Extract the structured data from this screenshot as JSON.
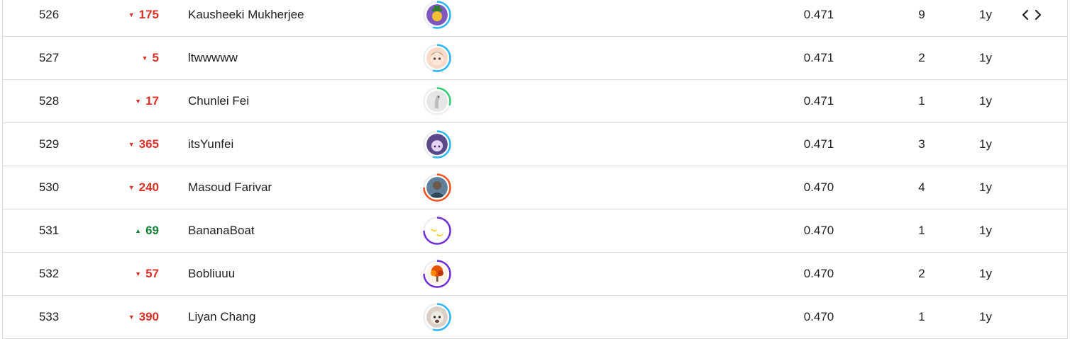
{
  "leaderboard": {
    "rows": [
      {
        "rank": "526",
        "delta": "175",
        "dir": "down",
        "team": "Kausheeki Mukherjee",
        "score": "0.471",
        "entries": "9",
        "last": "1y",
        "avatar": "owl-hat-avatar",
        "ring": "#29b6f6",
        "ring_frac": 0.55,
        "bg": "#7e57c2",
        "has_code": true
      },
      {
        "rank": "527",
        "delta": "5",
        "dir": "down",
        "team": "ltwwwww",
        "score": "0.471",
        "entries": "2",
        "last": "1y",
        "avatar": "anime-girl-avatar",
        "ring": "#29b6f6",
        "ring_frac": 0.55,
        "bg": "#f8d9c7",
        "has_code": false
      },
      {
        "rank": "528",
        "delta": "17",
        "dir": "down",
        "team": "Chunlei Fei",
        "score": "0.471",
        "entries": "1",
        "last": "1y",
        "avatar": "goose-avatar",
        "ring": "#2ecc71",
        "ring_frac": 0.3,
        "bg": "#e6e6e6",
        "has_code": false
      },
      {
        "rank": "529",
        "delta": "365",
        "dir": "down",
        "team": "itsYunfei",
        "score": "0.471",
        "entries": "3",
        "last": "1y",
        "avatar": "anime-purple-avatar",
        "ring": "#29b6f6",
        "ring_frac": 0.55,
        "bg": "#5b4a8a",
        "has_code": false
      },
      {
        "rank": "530",
        "delta": "240",
        "dir": "down",
        "team": "Masoud Farivar",
        "score": "0.470",
        "entries": "4",
        "last": "1y",
        "avatar": "person-photo-avatar",
        "ring": "#f4511e",
        "ring_frac": 0.75,
        "bg": "#5f7f9a",
        "has_code": false
      },
      {
        "rank": "531",
        "delta": "69",
        "dir": "up",
        "team": "BananaBoat",
        "score": "0.470",
        "entries": "1",
        "last": "1y",
        "avatar": "banana-avatar",
        "ring": "#6f2dd8",
        "ring_frac": 0.75,
        "bg": "#ffffff",
        "has_code": false
      },
      {
        "rank": "532",
        "delta": "57",
        "dir": "down",
        "team": "Bobliuuu",
        "score": "0.470",
        "entries": "2",
        "last": "1y",
        "avatar": "autumn-tree-avatar",
        "ring": "#6f2dd8",
        "ring_frac": 0.75,
        "bg": "#fff3e6",
        "has_code": false
      },
      {
        "rank": "533",
        "delta": "390",
        "dir": "down",
        "team": "Liyan Chang",
        "score": "0.470",
        "entries": "1",
        "last": "1y",
        "avatar": "cat-avatar",
        "ring": "#29b6f6",
        "ring_frac": 0.55,
        "bg": "#d9cfc5",
        "has_code": false
      }
    ]
  }
}
